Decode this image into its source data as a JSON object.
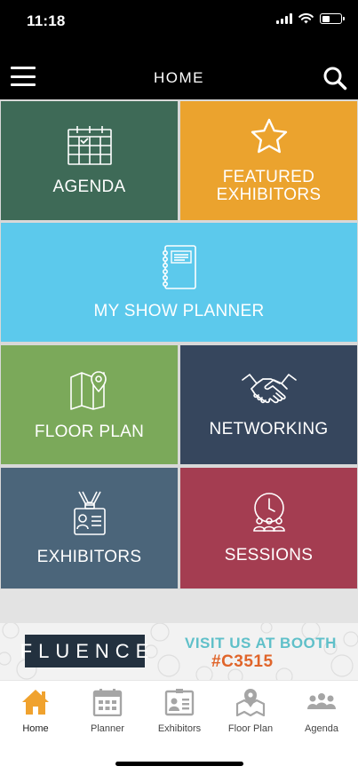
{
  "status_bar": {
    "time": "11:18"
  },
  "nav": {
    "title": "HOME",
    "menu_icon": "hamburger-menu-icon",
    "search_icon": "search-icon"
  },
  "tiles": [
    {
      "label": "AGENDA",
      "icon": "calendar-icon",
      "color": "#3e6a57"
    },
    {
      "label": "FEATURED\nEXHIBITORS",
      "icon": "star-icon",
      "color": "#eba32e"
    },
    {
      "label": "MY SHOW PLANNER",
      "icon": "notebook-icon",
      "color": "#5cc9ec"
    },
    {
      "label": "FLOOR PLAN",
      "icon": "map-pin-icon",
      "color": "#7ba95a"
    },
    {
      "label": "NETWORKING",
      "icon": "handshake-icon",
      "color": "#36465d"
    },
    {
      "label": "EXHIBITORS",
      "icon": "badge-icon",
      "color": "#4b657a"
    },
    {
      "label": "SESSIONS",
      "icon": "sessions-clock-icon",
      "color": "#a43d51"
    }
  ],
  "banner": {
    "logo_text": "FLUENCE",
    "line1": "VISIT US AT BOOTH",
    "line2": "#C3515",
    "colors": {
      "logo_bg": "#23313f",
      "line1": "#5fc0c9",
      "line2": "#e0652b"
    }
  },
  "tab_bar": {
    "active_color": "#f0a22e",
    "inactive_color": "#a5a5a5",
    "tabs": [
      {
        "label": "Home",
        "icon": "home-icon",
        "active": true
      },
      {
        "label": "Planner",
        "icon": "calendar-grid-icon",
        "active": false
      },
      {
        "label": "Exhibitors",
        "icon": "id-card-icon",
        "active": false
      },
      {
        "label": "Floor Plan",
        "icon": "map-pin-icon",
        "active": false
      },
      {
        "label": "Agenda",
        "icon": "people-icon",
        "active": false
      }
    ]
  }
}
